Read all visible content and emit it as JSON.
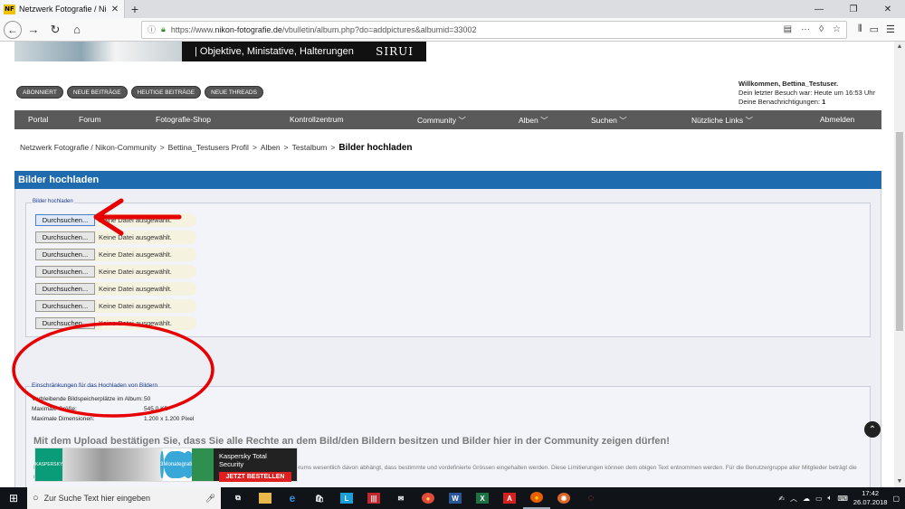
{
  "browser": {
    "tab_favicon": "NF",
    "tab_title": "Netzwerk Fotografie / Nikon-C",
    "url_prefix": "https://www.",
    "url_host": "nikon-fotografie.de",
    "url_path": "/vbulletin/album.php?do=addpictures&albumid=33002"
  },
  "banner": {
    "text": "| Objektive, Ministative, Halterungen",
    "brand": "SIRUI"
  },
  "pills": [
    "ABONNIERT",
    "NEUE BEITRÄGE",
    "HEUTIGE BEITRÄGE",
    "NEUE THREADS"
  ],
  "welcome": {
    "line1": "Willkommen, Bettina_Testuser.",
    "line2": "Dein letzter Besuch war: Heute um 16:53 Uhr",
    "line3_label": "Deine Benachrichtigungen: ",
    "line3_count": "1"
  },
  "mainnav": [
    "Portal",
    "Forum",
    "Fotografie-Shop",
    "Kontrollzentrum",
    "Community ﹀",
    "Alben ﹀",
    "Suchen ﹀",
    "Nützliche Links ﹀",
    "Abmelden"
  ],
  "breadcrumb": {
    "items": [
      "Netzwerk Fotografie / Nikon-Community",
      ">",
      "Bettina_Testusers Profil",
      ">",
      "Alben",
      ">",
      "Testalbum",
      ">"
    ],
    "current": "Bilder hochladen"
  },
  "section": {
    "title": "Bilder hochladen",
    "upload_legend": "Bilder hochladen",
    "browse_label": "Durchsuchen...",
    "no_file": "Keine Datei ausgewählt."
  },
  "limits": {
    "title": "Einschränkungen für das Hochladen von Bildern",
    "rows": [
      {
        "label": "Verbleibende Bildspeicherplätze im Album:",
        "value": "50"
      },
      {
        "label": "Maximale Größe:",
        "value": "545,0 KB"
      },
      {
        "label": "Maximale Dimensionen:",
        "value": "1.200 x 1.200 Pixel"
      }
    ],
    "confirm": "Mit dem Upload bestätigen Sie, dass Sie alle Rechte an dem Bild/den Bildern besitzen und Bilder hier in der Community zeigen dürfen!",
    "notice": "Bitte vor dem Upload unbedingt lesen, da die Qualität der Bilder in den Alben des Nikon Fotografie-Forums wesentlich davon abhängt, dass bestimmte und vordefinierte Grössen eingehalten werden. Diese Limitierungen können dem obigen Text entnommen werden. Für die Benutzergruppe aller Mitglieder beträgt die maximale Grösse uprakoadender Bilder 545 kb."
  },
  "ad": {
    "logo": "KASPERSKY",
    "badge_line1": "3",
    "badge_line2": "Monate",
    "badge_line3": "gratis",
    "title": "Kaspersky Total Security",
    "cta": "JETZT BESTELLEN"
  },
  "taskbar": {
    "search_placeholder": "Zur Suche Text hier eingeben",
    "time": "17:42",
    "date": "26.07.2018"
  },
  "colors": {
    "section_header": "#1e6bb0",
    "nav_bg": "#5a5a5a",
    "annotation": "#e60000"
  }
}
